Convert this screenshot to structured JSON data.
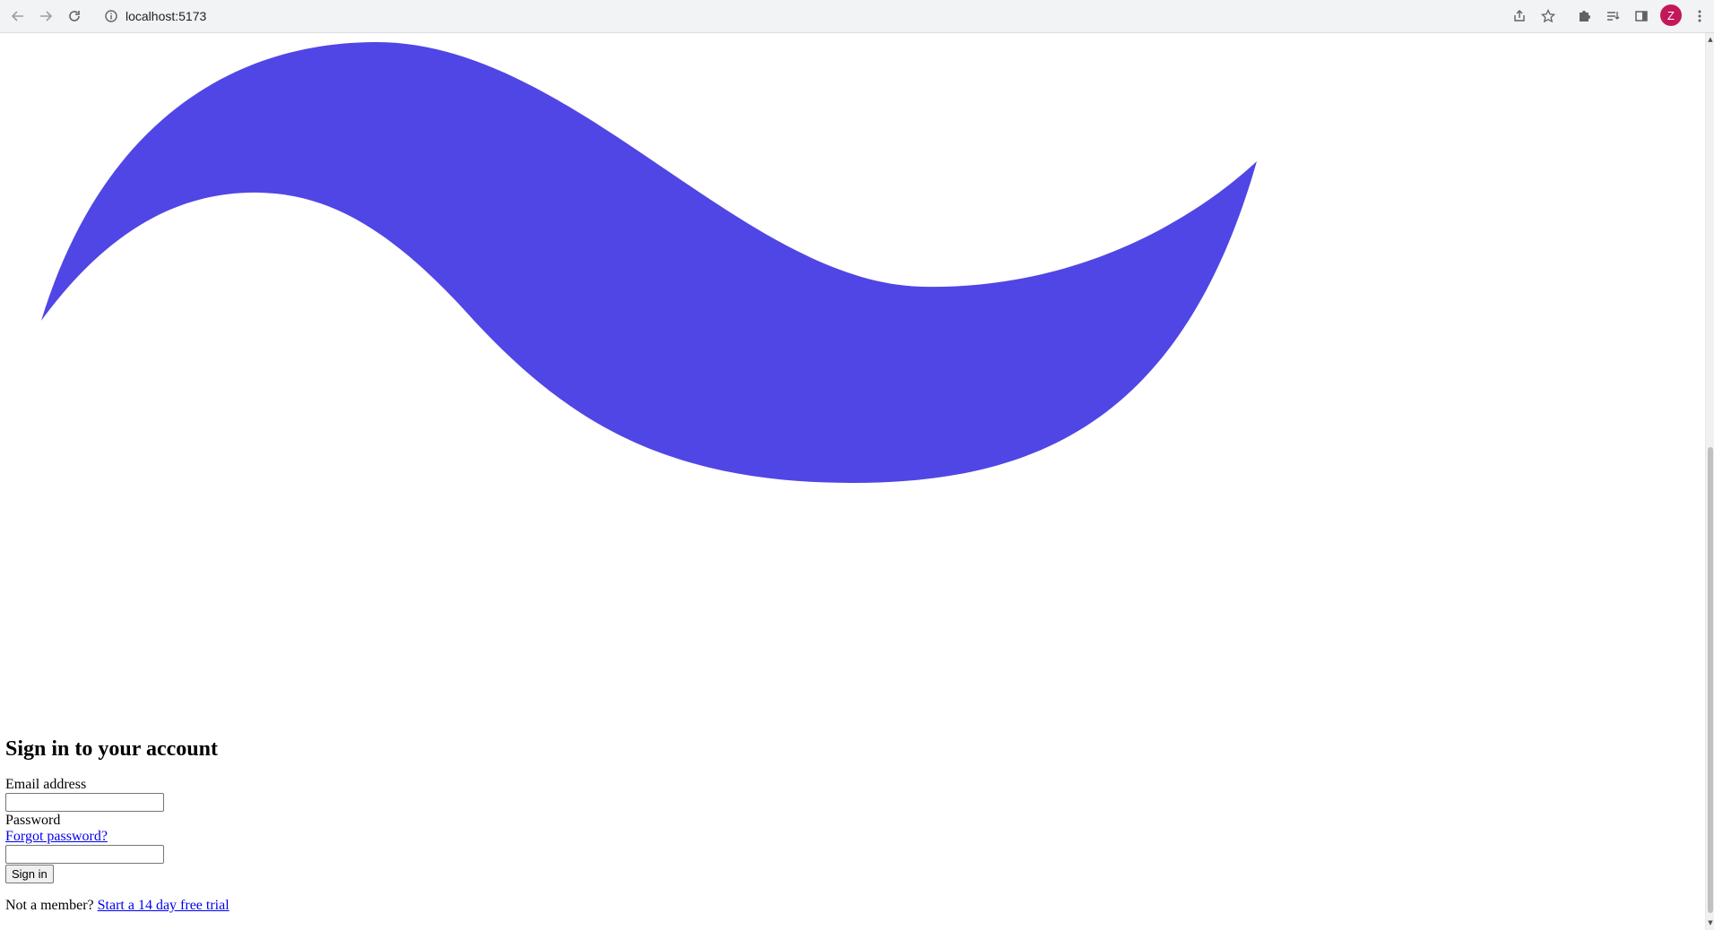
{
  "browser": {
    "url": "localhost:5173",
    "avatar_letter": "Z",
    "avatar_color": "#c2185b"
  },
  "logo": {
    "icon": "tailwind-wave-logo",
    "color": "#5046e5"
  },
  "form": {
    "title": "Sign in to your account",
    "email_label": "Email address",
    "email_value": "",
    "password_label": "Password",
    "forgot_link": "Forgot password?",
    "password_value": "",
    "submit_label": "Sign in",
    "footer_text": "Not a member?",
    "trial_link": "Start a 14 day free trial"
  }
}
